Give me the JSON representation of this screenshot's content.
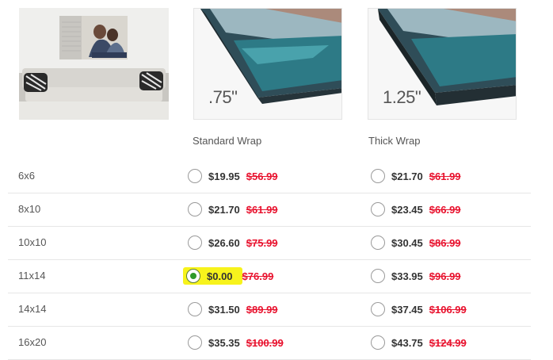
{
  "wraps": {
    "standard": {
      "label": "Standard Wrap",
      "depth": ".75\""
    },
    "thick": {
      "label": "Thick Wrap",
      "depth": "1.25\""
    }
  },
  "rows": [
    {
      "size": "6x6",
      "std_price": "$19.95",
      "std_orig": "$56.99",
      "thick_price": "$21.70",
      "thick_orig": "$61.99",
      "std_selected": false,
      "thick_selected": false
    },
    {
      "size": "8x10",
      "std_price": "$21.70",
      "std_orig": "$61.99",
      "thick_price": "$23.45",
      "thick_orig": "$66.99",
      "std_selected": false,
      "thick_selected": false
    },
    {
      "size": "10x10",
      "std_price": "$26.60",
      "std_orig": "$75.99",
      "thick_price": "$30.45",
      "thick_orig": "$86.99",
      "std_selected": false,
      "thick_selected": false
    },
    {
      "size": "11x14",
      "std_price": "$0.00",
      "std_orig": "$76.99",
      "thick_price": "$33.95",
      "thick_orig": "$96.99",
      "std_selected": true,
      "thick_selected": false
    },
    {
      "size": "14x14",
      "std_price": "$31.50",
      "std_orig": "$89.99",
      "thick_price": "$37.45",
      "thick_orig": "$106.99",
      "std_selected": false,
      "thick_selected": false
    },
    {
      "size": "16x20",
      "std_price": "$35.35",
      "std_orig": "$100.99",
      "thick_price": "$43.75",
      "thick_orig": "$124.99",
      "std_selected": false,
      "thick_selected": false
    }
  ],
  "colors": {
    "strike_price": "#e8112d",
    "highlight": "#f7f31c",
    "selected_dot": "#2e9a2a"
  }
}
